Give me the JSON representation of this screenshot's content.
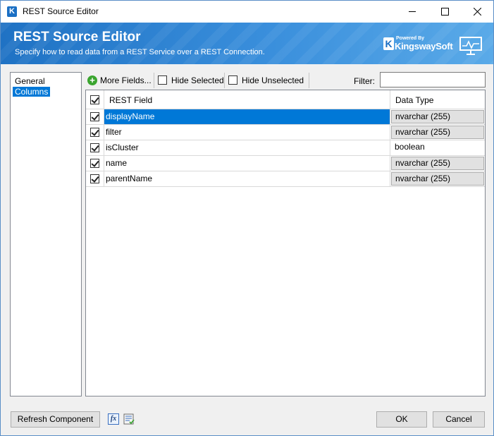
{
  "window": {
    "title": "REST Source Editor"
  },
  "banner": {
    "title": "REST Source Editor",
    "subtitle": "Specify how to read data from a REST Service over a REST Connection.",
    "logo_powered": "Powered By",
    "logo_name": "KingswaySoft",
    "logo_letter": "K"
  },
  "nav": {
    "items": [
      {
        "label": "General"
      },
      {
        "label": "Columns"
      }
    ],
    "selected": "Columns"
  },
  "toolbar": {
    "more_fields_label": "More Fields...",
    "hide_selected_label": "Hide Selected",
    "hide_unselected_label": "Hide Unselected",
    "filter_label": "Filter:",
    "filter_value": ""
  },
  "grid": {
    "header_field": "REST Field",
    "header_type": "Data Type",
    "rows": [
      {
        "field": "displayName",
        "type": "nvarchar (255)",
        "checked": true,
        "selected": true
      },
      {
        "field": "filter",
        "type": "nvarchar (255)",
        "checked": true,
        "selected": false
      },
      {
        "field": "isCluster",
        "type": "boolean",
        "checked": true,
        "selected": false
      },
      {
        "field": "name",
        "type": "nvarchar (255)",
        "checked": true,
        "selected": false
      },
      {
        "field": "parentName",
        "type": "nvarchar (255)",
        "checked": true,
        "selected": false
      }
    ]
  },
  "footer": {
    "refresh_label": "Refresh Component",
    "ok_label": "OK",
    "cancel_label": "Cancel"
  },
  "colors": {
    "accent": "#0078d7",
    "banner": "#2a80d0"
  }
}
